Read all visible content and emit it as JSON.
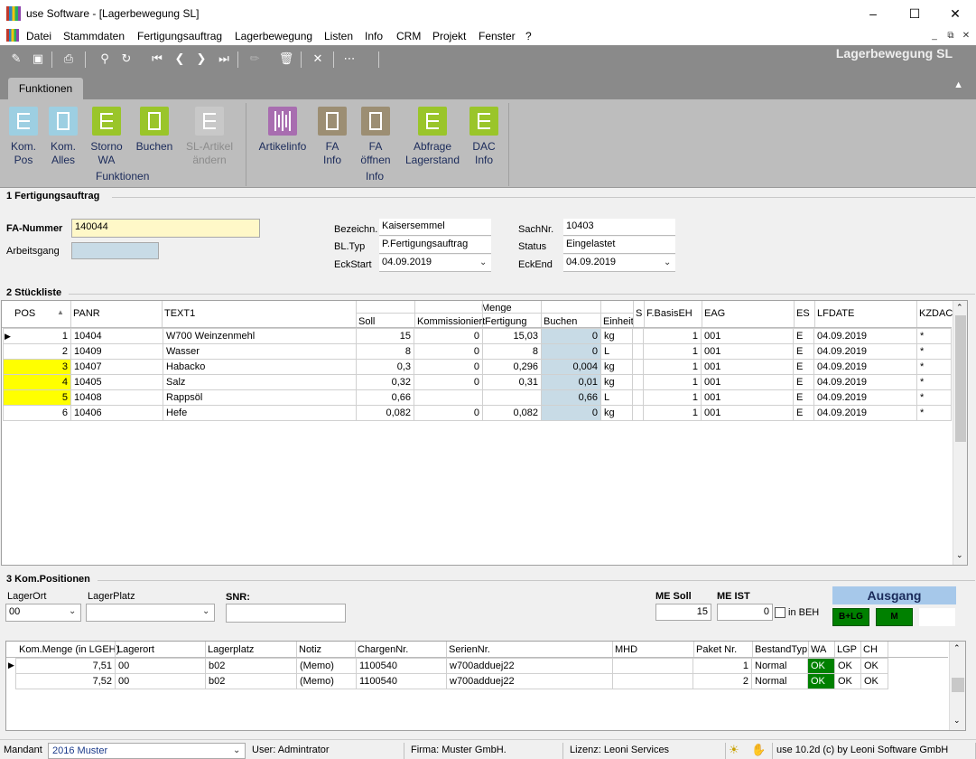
{
  "window": {
    "title": "use Software - [Lagerbewegung SL]"
  },
  "menu": [
    "Datei",
    "Stammdaten",
    "Fertigungsauftrag",
    "Lagerbewegung",
    "Listen",
    "Info",
    "CRM",
    "Projekt",
    "Fenster",
    "?"
  ],
  "module_title": "Lagerbewegung SL",
  "ribbon": {
    "tab": "Funktionen",
    "buttons": [
      {
        "label": "Kom.\nPos",
        "color": "#9dcfe2"
      },
      {
        "label": "Kom.\nAlles",
        "color": "#9dcfe2"
      },
      {
        "label": "Storno\nWA",
        "color": "#9ac52a"
      },
      {
        "label": "Buchen",
        "color": "#9ac52a"
      },
      {
        "label": "SL-Artikel\nändern",
        "color": "#c8c8c8"
      },
      {
        "label": "Artikelinfo",
        "color": "#a86db0"
      },
      {
        "label": "FA\nInfo",
        "color": "#9c8e73"
      },
      {
        "label": "FA\nöffnen",
        "color": "#9c8e73"
      },
      {
        "label": "Abfrage\nLagerstand",
        "color": "#9ac52a"
      },
      {
        "label": "DAC\nInfo",
        "color": "#9ac52a"
      }
    ],
    "groups": [
      "Funktionen",
      "Info"
    ]
  },
  "sections": {
    "s1": "1 Fertigungsauftrag",
    "s2": "2 Stückliste",
    "s3": "3 Kom.Positionen"
  },
  "fa": {
    "fa_nummer_label": "FA-Nummer",
    "fa_nummer": "140044",
    "arbeitsgang_label": "Arbeitsgang",
    "arbeitsgang": "",
    "bezeichn_label": "Bezeichn.",
    "bezeichn": "Kaisersemmel",
    "bltyp_label": "BL.Typ",
    "bltyp": "P.Fertigungsauftrag",
    "eckstart_label": "EckStart",
    "eckstart": "04.09.2019",
    "sachnr_label": "SachNr.",
    "sachnr": "10403",
    "status_label": "Status",
    "status": "Eingelastet",
    "eckend_label": "EckEnd",
    "eckend": "04.09.2019"
  },
  "stueckliste": {
    "group_header": "Menge",
    "columns": [
      "POS",
      "PANR",
      "TEXT1",
      "Soll",
      "Kommissioniert",
      "Fertigung",
      "Buchen",
      "Einheit",
      "S",
      "F.BasisEH",
      "EAG",
      "ES",
      "LFDATE",
      "KZDAC"
    ],
    "rows": [
      {
        "pos": "1",
        "panr": "10404",
        "text": "W700 Weinzenmehl",
        "soll": "15",
        "kom": "0",
        "fert": "15,03",
        "buchen": "0",
        "einh": "kg",
        "s": "",
        "basis": "1",
        "eag": "001",
        "es": "E",
        "lfdate": "04.09.2019",
        "kz": "*",
        "hl": false
      },
      {
        "pos": "2",
        "panr": "10409",
        "text": "Wasser",
        "soll": "8",
        "kom": "0",
        "fert": "8",
        "buchen": "0",
        "einh": "L",
        "s": "",
        "basis": "1",
        "eag": "001",
        "es": "E",
        "lfdate": "04.09.2019",
        "kz": "*",
        "hl": false
      },
      {
        "pos": "3",
        "panr": "10407",
        "text": "Habacko",
        "soll": "0,3",
        "kom": "0",
        "fert": "0,296",
        "buchen": "0,004",
        "einh": "kg",
        "s": "",
        "basis": "1",
        "eag": "001",
        "es": "E",
        "lfdate": "04.09.2019",
        "kz": "*",
        "hl": true
      },
      {
        "pos": "4",
        "panr": "10405",
        "text": "Salz",
        "soll": "0,32",
        "kom": "0",
        "fert": "0,31",
        "buchen": "0,01",
        "einh": "kg",
        "s": "",
        "basis": "1",
        "eag": "001",
        "es": "E",
        "lfdate": "04.09.2019",
        "kz": "*",
        "hl": true
      },
      {
        "pos": "5",
        "panr": "10408",
        "text": "Rappsöl",
        "soll": "0,66",
        "kom": "",
        "fert": "",
        "buchen": "0,66",
        "einh": "L",
        "s": "",
        "basis": "1",
        "eag": "001",
        "es": "E",
        "lfdate": "04.09.2019",
        "kz": "*",
        "hl": true
      },
      {
        "pos": "6",
        "panr": "10406",
        "text": "Hefe",
        "soll": "0,082",
        "kom": "0",
        "fert": "0,082",
        "buchen": "0",
        "einh": "kg",
        "s": "",
        "basis": "1",
        "eag": "001",
        "es": "E",
        "lfdate": "04.09.2019",
        "kz": "*",
        "hl": false
      }
    ]
  },
  "kom": {
    "lagerort_label": "LagerOrt",
    "lagerort": "00",
    "lagerplatz_label": "LagerPlatz",
    "lagerplatz": "",
    "snr_label": "SNR:",
    "snr": "",
    "me_soll_label": "ME Soll",
    "me_soll": "15",
    "me_ist_label": "ME IST",
    "me_ist": "0",
    "in_beh_label": "in BEH",
    "ausgang": "Ausgang",
    "btn_blg": "B+LG",
    "btn_m": "M",
    "columns": [
      "Kom.Menge (in LGEH)",
      "Lagerort",
      "Lagerplatz",
      "Notiz",
      "ChargenNr.",
      "SerienNr.",
      "MHD",
      "Paket Nr.",
      "BestandTyp",
      "WA",
      "LGP",
      "CH"
    ],
    "rows": [
      {
        "menge": "7,51",
        "lagerort": "00",
        "lagerplatz": "b02",
        "notiz": "(Memo)",
        "charge": "1100540",
        "serie": "w700adduej22",
        "mhd": "",
        "paket": "1",
        "typ": "Normal",
        "wa": "OK",
        "lgp": "OK",
        "ch": "OK"
      },
      {
        "menge": "7,52",
        "lagerort": "00",
        "lagerplatz": "b02",
        "notiz": "(Memo)",
        "charge": "1100540",
        "serie": "w700adduej22",
        "mhd": "",
        "paket": "2",
        "typ": "Normal",
        "wa": "OK",
        "lgp": "OK",
        "ch": "OK"
      }
    ]
  },
  "status": {
    "mandant_label": "Mandant",
    "mandant": "2016 Muster",
    "user": "User: Admintrator",
    "firma": "Firma: Muster GmbH.",
    "lizenz": "Lizenz: Leoni Services",
    "version": "use 10.2d (c) by Leoni Software GmbH"
  },
  "colors": {
    "toolbar": "#8a8a8a",
    "ribbon": "#bdbdbd",
    "highlight": "#ffff00",
    "buchen_cell": "#c8dbe6",
    "ok": "#008000",
    "ausgang": "#a6c8ea"
  }
}
